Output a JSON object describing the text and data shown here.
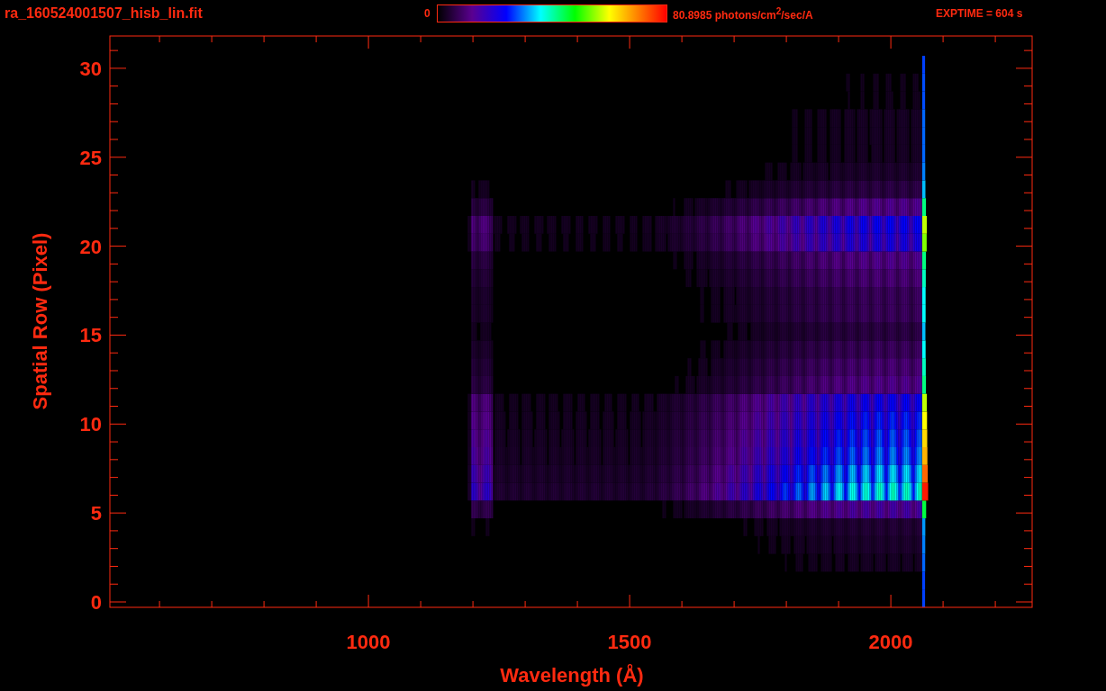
{
  "header": {
    "filename": "ra_160524001507_hisb_lin.fit",
    "colorbar_min": "0",
    "colorbar_max": "80.8985 photons/cm$^{2}$/sec/A",
    "exptime": "EXPTIME = 604 s"
  },
  "plot": {
    "xlabel": "Wavelength (Å)",
    "ylabel": "Spatial Row (Pixel)",
    "xtick_labels": [
      "1000",
      "1500",
      "2000"
    ],
    "ytick_labels": [
      "30",
      "25",
      "20",
      "15",
      "10",
      "5",
      "0"
    ]
  }
}
